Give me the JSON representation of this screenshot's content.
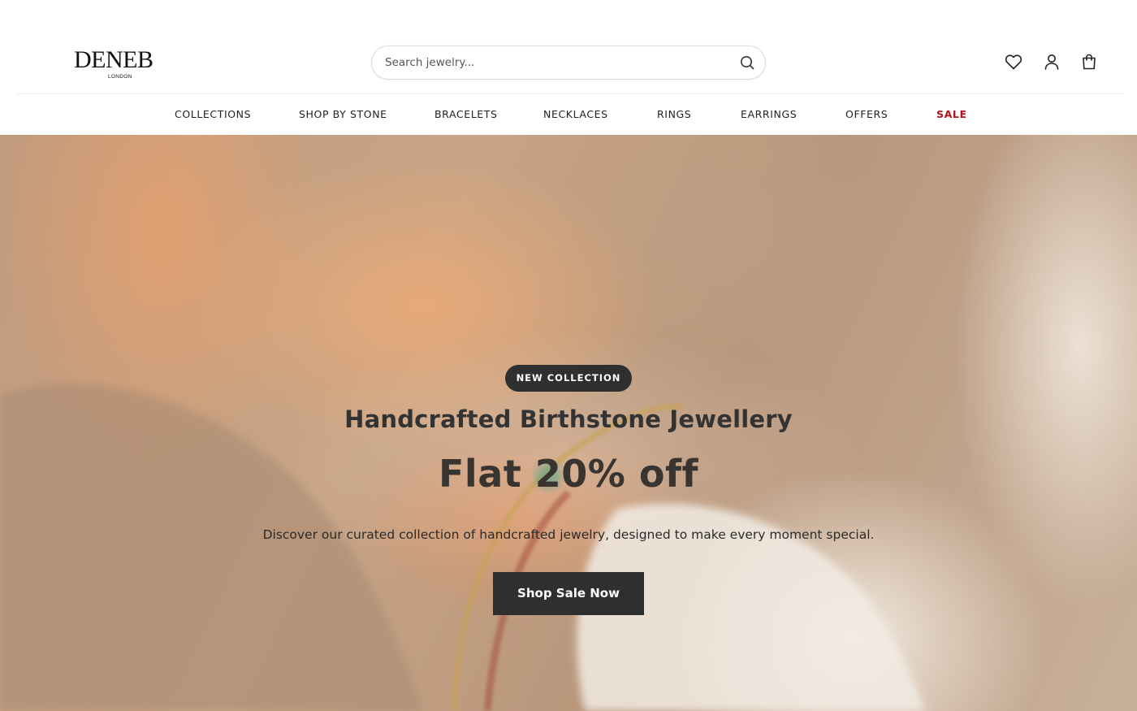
{
  "brand": {
    "name": "DENEB",
    "subtitle": "LONDON"
  },
  "search": {
    "placeholder": "Search jewelry...",
    "value": ""
  },
  "nav": {
    "items": [
      {
        "label": "COLLECTIONS"
      },
      {
        "label": "SHOP BY STONE"
      },
      {
        "label": "BRACELETS"
      },
      {
        "label": "NECKLACES"
      },
      {
        "label": "RINGS"
      },
      {
        "label": "EARRINGS"
      },
      {
        "label": "OFFERS"
      },
      {
        "label": "SALE",
        "color": "#b3131b"
      }
    ]
  },
  "icons": {
    "search": "search-icon",
    "wishlist": "heart-icon",
    "account": "user-icon",
    "cart": "shopping-bag-icon"
  },
  "hero": {
    "badge": "NEW COLLECTION",
    "title": "Handcrafted Birthstone Jewellery",
    "offer": "Flat 20% off",
    "description": "Discover our curated collection of handcrafted jewelry, designed to make every moment special.",
    "cta_label": "Shop Sale Now"
  },
  "colors": {
    "accent_dark": "#2f2f2f",
    "sale": "#b3131b"
  }
}
